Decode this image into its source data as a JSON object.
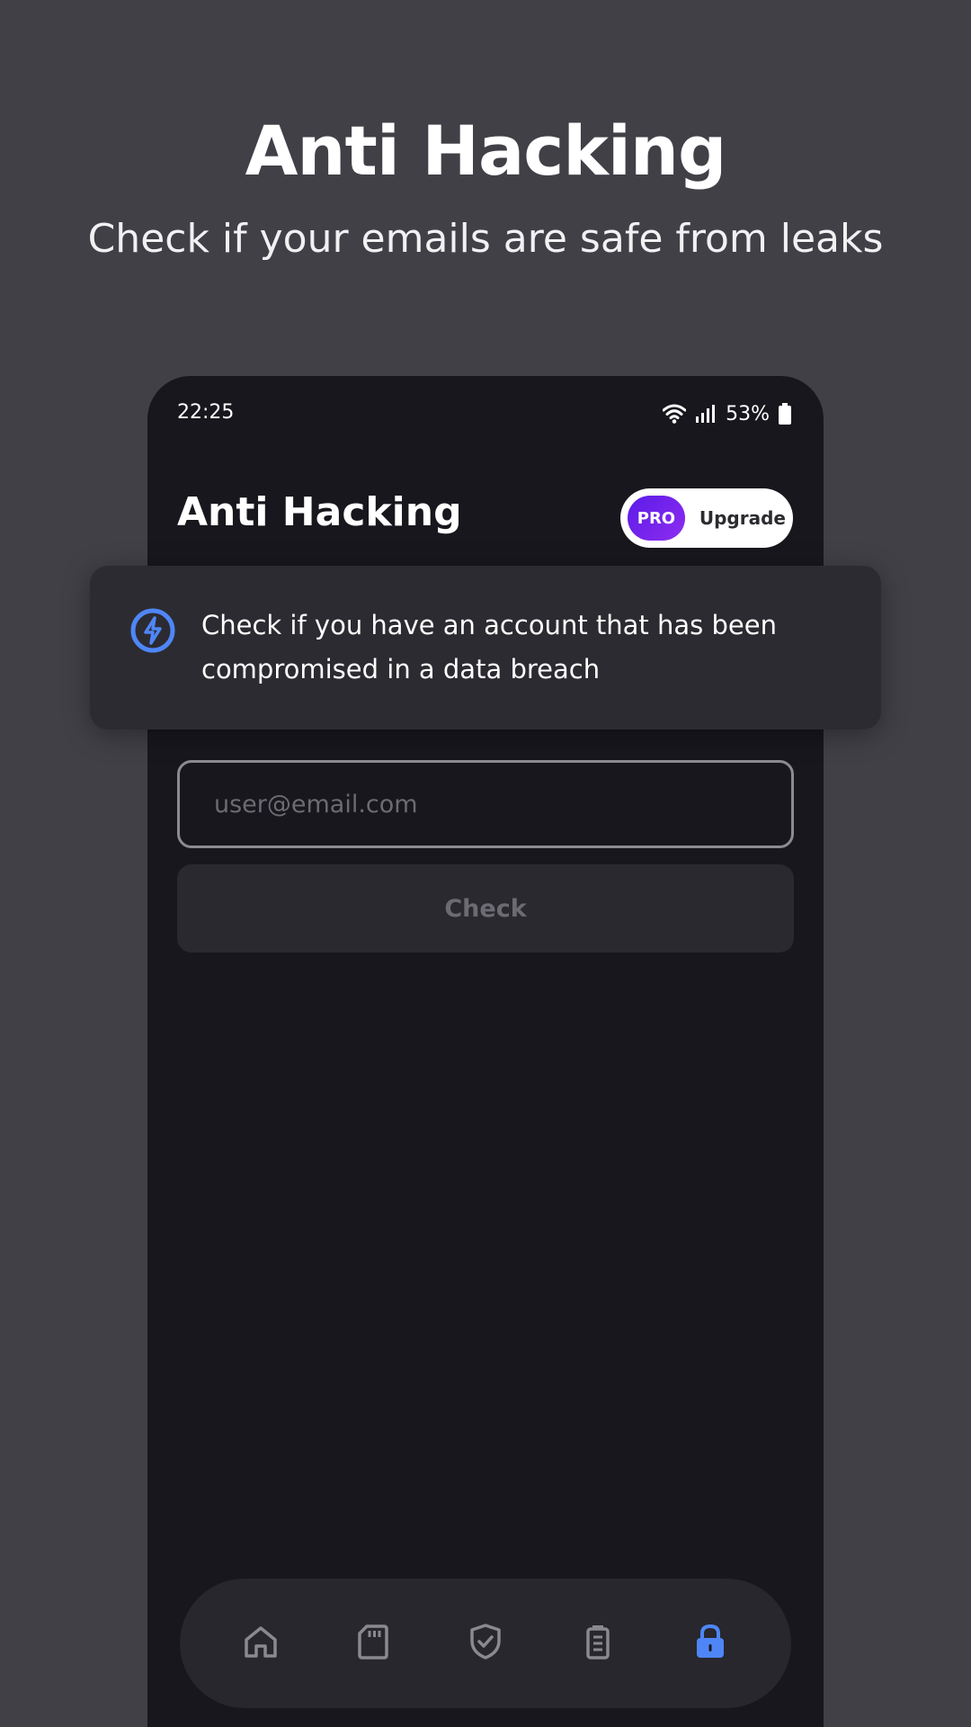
{
  "promo": {
    "title": "Anti Hacking",
    "subtitle": "Check if your emails are safe from leaks"
  },
  "status_bar": {
    "time": "22:25",
    "battery": "53%",
    "icons": [
      "wifi-icon",
      "signal-icon",
      "battery-icon"
    ]
  },
  "app": {
    "title": "Anti Hacking",
    "upgrade": {
      "badge": "PRO",
      "label": "Upgrade"
    }
  },
  "info_card": {
    "icon": "bolt-circle-icon",
    "text": "Check if you have an account that has been compromised in a data breach"
  },
  "form": {
    "email_placeholder": "user@email.com",
    "email_value": "",
    "check_label": "Check"
  },
  "bottom_nav": {
    "items": [
      {
        "icon": "home-icon",
        "active": false
      },
      {
        "icon": "sd-card-icon",
        "active": false
      },
      {
        "icon": "shield-check-icon",
        "active": false
      },
      {
        "icon": "battery-clipboard-icon",
        "active": false
      },
      {
        "icon": "lock-icon",
        "active": true
      }
    ]
  },
  "colors": {
    "background": "#414047",
    "phone_background": "#18171d",
    "card_background": "#2c2b31",
    "accent_blue": "#4f86f7",
    "pro_gradient_start": "#5b1ce8",
    "pro_gradient_end": "#8e2cf0",
    "inactive_icon": "#8a8990"
  }
}
